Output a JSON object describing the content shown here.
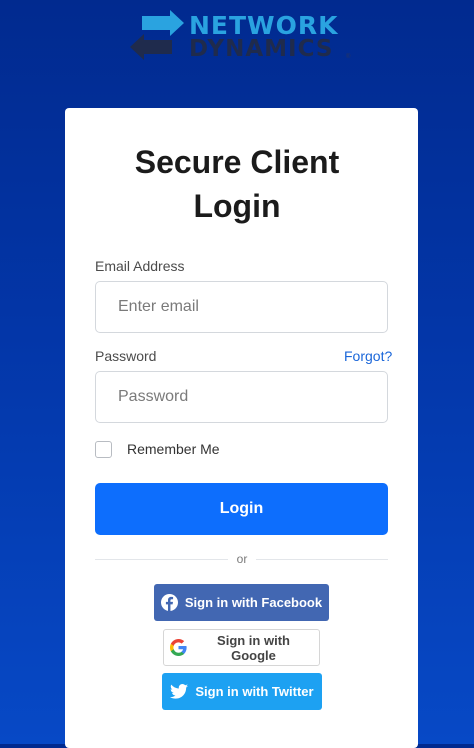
{
  "brand": {
    "line1": "NETWORK",
    "line2": "DYNAMICS",
    "registered": "®"
  },
  "form": {
    "title_line1": "Secure Client",
    "title_line2": "Login",
    "email_label": "Email Address",
    "email_placeholder": "Enter email",
    "password_label": "Password",
    "password_placeholder": "Password",
    "forgot_link": "Forgot?",
    "remember_label": "Remember Me",
    "remember_checked": false,
    "login_button": "Login",
    "divider_text": "or"
  },
  "social": {
    "facebook": "Sign in with Facebook",
    "google": "Sign in with Google",
    "twitter": "Sign in with Twitter"
  },
  "colors": {
    "background": "#0336a8",
    "primary": "#0d6efd",
    "facebook": "#4267b2",
    "twitter": "#1da1f2",
    "link": "#1a66d9"
  },
  "icons": [
    "network-dynamics-logo-icon",
    "facebook-icon",
    "google-icon",
    "twitter-icon"
  ]
}
